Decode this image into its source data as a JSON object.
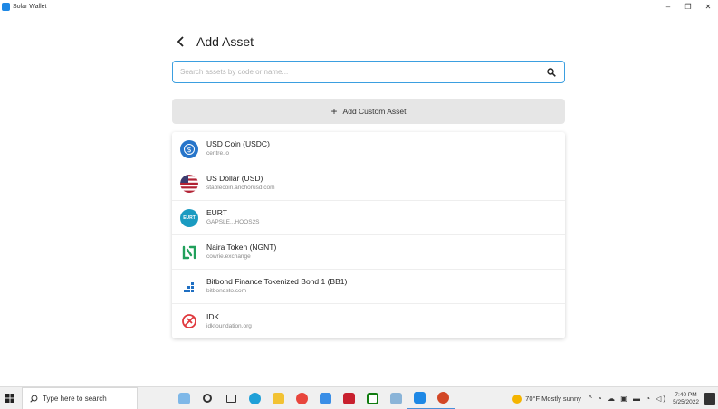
{
  "window": {
    "title": "Solar Wallet",
    "controls": {
      "minimize": "–",
      "maximize": "❐",
      "close": "✕"
    }
  },
  "header": {
    "back_icon": "chevron-left-icon",
    "title": "Add Asset"
  },
  "search": {
    "placeholder": "Search assets by code or name...",
    "value": "",
    "icon": "search-icon"
  },
  "add_custom": {
    "icon": "plus-icon",
    "label": "Add Custom Asset"
  },
  "assets": [
    {
      "name": "USD Coin (USDC)",
      "domain": "centre.io",
      "icon": "usdc-logo-icon",
      "color": "#2775ca"
    },
    {
      "name": "US Dollar (USD)",
      "domain": "stablecoin.anchorusd.com",
      "icon": "us-flag-icon",
      "color": "#b22234"
    },
    {
      "name": "EURT",
      "domain": "GAPSLE...HOOS2S",
      "icon": "eurt-logo-icon",
      "icon_text": "EURT",
      "color": "#1a9bc1"
    },
    {
      "name": "Naira Token (NGNT)",
      "domain": "cowrie.exchange",
      "icon": "ngnt-logo-icon",
      "color": "#21a05b"
    },
    {
      "name": "Bitbond Finance Tokenized Bond 1 (BB1)",
      "domain": "bitbondsto.com",
      "icon": "bitbond-logo-icon",
      "color": "#1f6fc2"
    },
    {
      "name": "IDK",
      "domain": "idkfoundation.org",
      "icon": "idk-logo-icon",
      "color": "#e0393e"
    }
  ],
  "taskbar": {
    "search_placeholder": "Type here to search",
    "weather": "70°F  Mostly sunny",
    "time": "7:40 PM",
    "date": "5/25/2022"
  }
}
